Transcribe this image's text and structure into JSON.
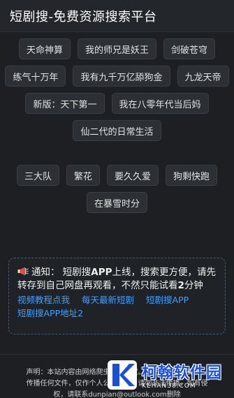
{
  "header": {
    "title": "短剧搜-免费资源搜索平台"
  },
  "tags_group1": [
    [
      "天命神算",
      "我的师兄是妖王",
      "剑破苍穹"
    ],
    [
      "练气十万年",
      "我有九千万亿舔狗金",
      "九龙天帝"
    ],
    [
      "新版：天下第一",
      "我在八零年代当后妈"
    ],
    [
      "仙二代的日常生活"
    ]
  ],
  "tags_group2": [
    [
      "三大队",
      "繁花",
      "要久久爱",
      "狗剩快跑"
    ],
    [
      "在暴雪时分"
    ]
  ],
  "notice": {
    "icon": "megaphone-icon",
    "label": "通知：",
    "text_a": "短剧搜",
    "text_b": "APP",
    "text_c": "上线，搜索更方便，请先转存到自己网盘再观看，不然只能试看",
    "text_d": "2",
    "text_e": "分钟",
    "links": [
      "视频教程点我",
      "每天最新短剧",
      "短剧搜APP",
      "短剧搜APP地址2"
    ]
  },
  "footer": {
    "line1": "声明：本站内容由网络爬虫自动抓取。本站不储存、复制、",
    "line2": "传播任何文件，仅作个人公益学习，请勿非法传播，如有侵",
    "line3": "权，请联系dunpian@outlook.com删除",
    "copy": "©"
  },
  "watermark": {
    "main": "柯翰软件园",
    "sub": "KEHAN38.COM"
  },
  "colors": {
    "background": "#1d1f23",
    "link": "#3fa0ff",
    "tag_bg": "#2c2f34"
  }
}
